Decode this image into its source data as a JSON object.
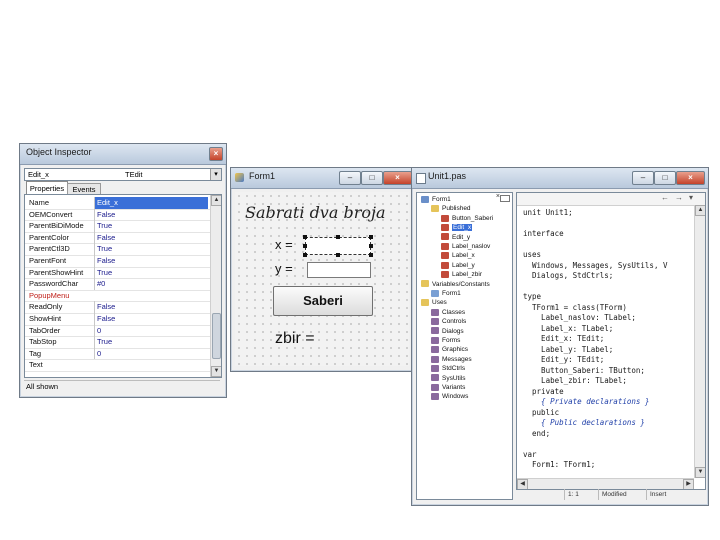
{
  "object_inspector": {
    "title": "Object Inspector",
    "close_glyph": "×",
    "selector_name": "Edit_x",
    "selector_type": "TEdit",
    "selector_arrow": "▾",
    "tabs": [
      {
        "label": "Properties"
      },
      {
        "label": "Events"
      }
    ],
    "properties": [
      {
        "name": "Name",
        "value": "Edit_x"
      },
      {
        "name": "OEMConvert",
        "value": "False"
      },
      {
        "name": "ParentBiDiMode",
        "value": "True"
      },
      {
        "name": "ParentColor",
        "value": "False"
      },
      {
        "name": "ParentCtl3D",
        "value": "True"
      },
      {
        "name": "ParentFont",
        "value": "False"
      },
      {
        "name": "ParentShowHint",
        "value": "True"
      },
      {
        "name": "PasswordChar",
        "value": "#0"
      },
      {
        "name": "PopupMenu",
        "value": ""
      },
      {
        "name": "ReadOnly",
        "value": "False"
      },
      {
        "name": "ShowHint",
        "value": "False"
      },
      {
        "name": "TabOrder",
        "value": "0"
      },
      {
        "name": "TabStop",
        "value": "True"
      },
      {
        "name": "Tag",
        "value": "0"
      },
      {
        "name": "Text",
        "value": ""
      }
    ],
    "status": "All shown"
  },
  "form1": {
    "title": "Form1",
    "heading": "Sabrati dva broja",
    "label_x": "x =",
    "label_y": "y =",
    "button": "Saberi",
    "zbir": "zbir ="
  },
  "editor": {
    "title": "Unit1.pas",
    "tree": [
      {
        "label": "Form1",
        "level": 0,
        "color": "#6a8fc9"
      },
      {
        "label": "Published",
        "level": 1,
        "color": "#e5c45a"
      },
      {
        "label": "Button_Saberi",
        "level": 2,
        "color": "#c24a3a"
      },
      {
        "label": "Edit_x",
        "level": 2,
        "color": "#c24a3a",
        "selected": true
      },
      {
        "label": "Edit_y",
        "level": 2,
        "color": "#c24a3a"
      },
      {
        "label": "Label_naslov",
        "level": 2,
        "color": "#c24a3a"
      },
      {
        "label": "Label_x",
        "level": 2,
        "color": "#c24a3a"
      },
      {
        "label": "Label_y",
        "level": 2,
        "color": "#c24a3a"
      },
      {
        "label": "Label_zbir",
        "level": 2,
        "color": "#c24a3a"
      },
      {
        "label": "Variables/Constants",
        "level": 0,
        "color": "#e5c45a"
      },
      {
        "label": "Form1",
        "level": 1,
        "color": "#7aa0d4"
      },
      {
        "label": "Uses",
        "level": 0,
        "color": "#e5c45a"
      },
      {
        "label": "Classes",
        "level": 1,
        "color": "#8a6a9e"
      },
      {
        "label": "Controls",
        "level": 1,
        "color": "#8a6a9e"
      },
      {
        "label": "Dialogs",
        "level": 1,
        "color": "#8a6a9e"
      },
      {
        "label": "Forms",
        "level": 1,
        "color": "#8a6a9e"
      },
      {
        "label": "Graphics",
        "level": 1,
        "color": "#8a6a9e"
      },
      {
        "label": "Messages",
        "level": 1,
        "color": "#8a6a9e"
      },
      {
        "label": "StdCtrls",
        "level": 1,
        "color": "#8a6a9e"
      },
      {
        "label": "SysUtils",
        "level": 1,
        "color": "#8a6a9e"
      },
      {
        "label": "Variants",
        "level": 1,
        "color": "#8a6a9e"
      },
      {
        "label": "Windows",
        "level": 1,
        "color": "#8a6a9e"
      }
    ],
    "code": [
      "unit Unit1;",
      "",
      "interface",
      "",
      "uses",
      "  Windows, Messages, SysUtils, V",
      "  Dialogs, StdCtrls;",
      "",
      "type",
      "  TForm1 = class(TForm)",
      "    Label_naslov: TLabel;",
      "    Label_x: TLabel;",
      "    Edit_x: TEdit;",
      "    Label_y: TLabel;",
      "    Edit_y: TEdit;",
      "    Button_Saberi: TButton;",
      "    Label_zbir: TLabel;",
      "  private",
      "    { Private declarations }",
      "  public",
      "    { Public declarations }",
      "  end;",
      "",
      "var",
      "  Form1: TForm1;"
    ],
    "status": {
      "position": "1: 1",
      "mode": "Modified",
      "insert": "Insert"
    }
  },
  "glyphs": {
    "minimize": "–",
    "maximize": "□",
    "close": "×",
    "up": "▲",
    "down": "▼",
    "left": "◀",
    "right": "▶",
    "nav_back": "←",
    "nav_fwd": "→",
    "nav_drop": "▾"
  }
}
